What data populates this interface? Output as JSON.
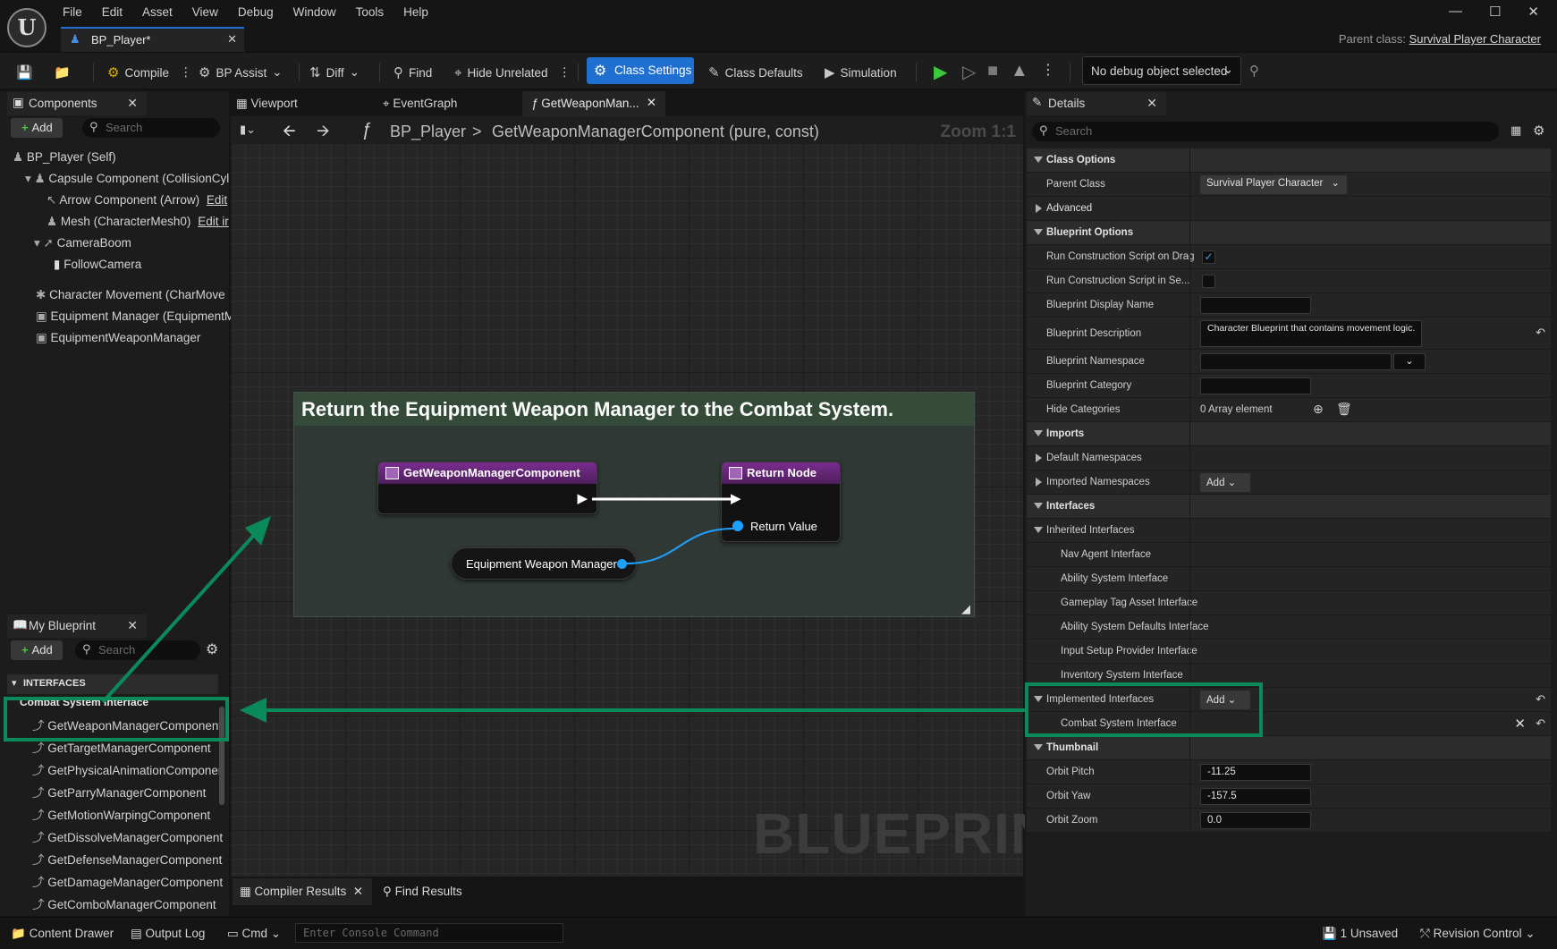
{
  "menubar": {
    "items": [
      "File",
      "Edit",
      "Asset",
      "View",
      "Debug",
      "Window",
      "Tools",
      "Help"
    ]
  },
  "document_tab": {
    "title": "BP_Player*"
  },
  "parent_class": {
    "label": "Parent class:",
    "value": "Survival Player Character"
  },
  "toolbar": {
    "compile": "Compile",
    "bp_assist": "BP Assist",
    "diff": "Diff",
    "find": "Find",
    "hide_unrelated": "Hide Unrelated",
    "class_settings": "Class Settings",
    "class_defaults": "Class Defaults",
    "simulation": "Simulation",
    "debug_object": "No debug object selected"
  },
  "components": {
    "tab": "Components",
    "add": "Add",
    "search_placeholder": "Search",
    "items": [
      "BP_Player (Self)",
      "Capsule Component (CollisionCyl",
      "Arrow Component (Arrow)",
      "Mesh (CharacterMesh0)",
      "CameraBoom",
      "FollowCamera",
      "Character Movement (CharMove",
      "Equipment Manager (EquipmentM",
      "EquipmentWeaponManager"
    ],
    "edit_link_1": "Edit",
    "edit_link_2": "Edit ir"
  },
  "graph_tabs": {
    "viewport": "Viewport",
    "eventgraph": "EventGraph",
    "function": "GetWeaponMan..."
  },
  "breadcrumb": {
    "root": "BP_Player",
    "separator": ">",
    "function": "GetWeaponManagerComponent (pure, const)",
    "zoom": "Zoom 1:1"
  },
  "graph": {
    "comment": "Return the Equipment Weapon Manager to the Combat System.",
    "entry_node": "GetWeaponManagerComponent",
    "return_node": "Return Node",
    "return_pin": "Return Value",
    "var_node": "Equipment Weapon Manager",
    "watermark": "BLUEPRINT"
  },
  "my_blueprint": {
    "tab": "My Blueprint",
    "add": "Add",
    "search_placeholder": "Search",
    "section": "INTERFACES",
    "group": "Combat System Interface",
    "functions": [
      "GetWeaponManagerComponent",
      "GetTargetManagerComponent",
      "GetPhysicalAnimationComponer",
      "GetParryManagerComponent",
      "GetMotionWarpingComponent",
      "GetDissolveManagerComponent",
      "GetDefenseManagerComponent",
      "GetDamageManagerComponent",
      "GetComboManagerComponent"
    ]
  },
  "bottom_tabs": {
    "compiler": "Compiler Results",
    "find": "Find Results"
  },
  "details": {
    "tab": "Details",
    "search_placeholder": "Search",
    "class_options": "Class Options",
    "parent_class_label": "Parent Class",
    "parent_class_value": "Survival Player Character",
    "advanced": "Advanced",
    "blueprint_options": "Blueprint Options",
    "run_drag": "Run Construction Script on Drag",
    "run_seq": "Run Construction Script in Se...",
    "display_name": "Blueprint Display Name",
    "description": "Blueprint Description",
    "description_value": "Character Blueprint that contains movement logic.",
    "namespace": "Blueprint Namespace",
    "category": "Blueprint Category",
    "hide_categories": "Hide Categories",
    "hide_categories_value": "0 Array element",
    "imports": "Imports",
    "default_namespaces": "Default Namespaces",
    "imported_namespaces": "Imported Namespaces",
    "add": "Add",
    "interfaces": "Interfaces",
    "inherited": "Inherited Interfaces",
    "inherited_items": [
      "Nav Agent Interface",
      "Ability System Interface",
      "Gameplay Tag Asset Interface",
      "Ability System Defaults Interface",
      "Input Setup Provider Interface",
      "Inventory System Interface"
    ],
    "implemented": "Implemented Interfaces",
    "implemented_item": "Combat System Interface",
    "thumbnail": "Thumbnail",
    "orbit_pitch": "Orbit Pitch",
    "orbit_pitch_value": "-11.25",
    "orbit_yaw": "Orbit Yaw",
    "orbit_yaw_value": "-157.5",
    "orbit_zoom": "Orbit Zoom",
    "orbit_zoom_value": "0.0"
  },
  "statusbar": {
    "content_drawer": "Content Drawer",
    "output_log": "Output Log",
    "cmd": "Cmd",
    "console_placeholder": "Enter Console Command",
    "unsaved": "1 Unsaved",
    "revision": "Revision Control"
  },
  "colors": {
    "accent": "#1f6fd1",
    "annotation": "#0a8a5a",
    "function_header": "#7a2d8e",
    "pin": "#1fa0ff"
  }
}
